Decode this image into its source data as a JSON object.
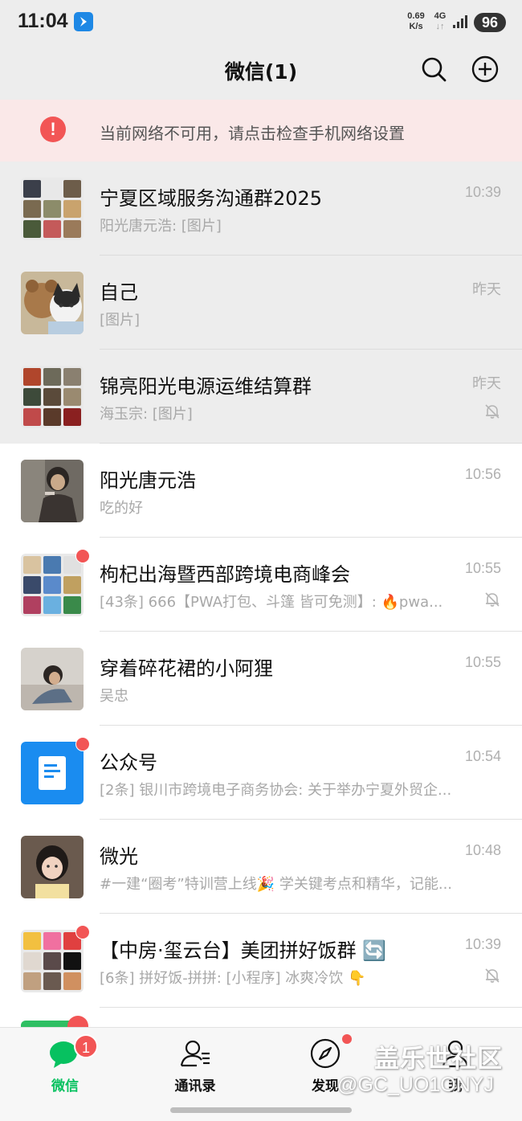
{
  "status_bar": {
    "time": "11:04",
    "speed_value": "0.69",
    "speed_unit": "K/s",
    "network_type": "4G",
    "network_arrows": "↓↑",
    "battery": "96"
  },
  "header": {
    "title": "微信(1)"
  },
  "banner": {
    "icon_text": "!",
    "message": "当前网络不可用，请点击检查手机网络设置"
  },
  "chats": [
    {
      "name": "宁夏区域服务沟通群2025",
      "preview": "阳光唐元浩: [图片]",
      "time": "10:39",
      "muted": false,
      "pinned": true,
      "unread_dot": false
    },
    {
      "name": "自己",
      "preview": "[图片]",
      "time": "昨天",
      "muted": false,
      "pinned": true,
      "unread_dot": false
    },
    {
      "name": "锦亮阳光电源运维结算群",
      "preview": "海玉宗: [图片]",
      "time": "昨天",
      "muted": true,
      "pinned": true,
      "unread_dot": false
    },
    {
      "name": "阳光唐元浩",
      "preview": "吃的好",
      "time": "10:56",
      "muted": false,
      "pinned": false,
      "unread_dot": false
    },
    {
      "name": "枸杞出海暨西部跨境电商峰会",
      "preview": "[43条] 666【PWA打包、斗篷 皆可免测】: 🔥pwa...",
      "time": "10:55",
      "muted": true,
      "pinned": false,
      "unread_dot": true
    },
    {
      "name": "穿着碎花裙的小阿狸",
      "preview": "吴忠",
      "time": "10:55",
      "muted": false,
      "pinned": false,
      "unread_dot": false
    },
    {
      "name": "公众号",
      "preview": "[2条] 银川市跨境电子商务协会: 关于举办宁夏外贸企...",
      "time": "10:54",
      "muted": false,
      "pinned": false,
      "unread_dot": true
    },
    {
      "name": "微光",
      "preview": "#一建“圈考”特训营上线🎉 学关键考点和精华，记能...",
      "time": "10:48",
      "muted": false,
      "pinned": false,
      "unread_dot": false
    },
    {
      "name": "【中房·玺云台】美团拼好饭群 🔄",
      "preview": "[6条] 拼好饭-拼拼: [小程序] 冰爽冷饮 👇",
      "time": "10:39",
      "muted": true,
      "pinned": false,
      "unread_dot": true
    }
  ],
  "tabs": [
    {
      "label": "微信",
      "icon": "chat-bubbles-icon",
      "badge": "1",
      "active": true
    },
    {
      "label": "通讯录",
      "icon": "contacts-icon",
      "badge": "",
      "active": false
    },
    {
      "label": "发现",
      "icon": "compass-icon",
      "badge": "",
      "active": false
    },
    {
      "label": "我",
      "icon": "person-icon",
      "badge": "",
      "active": false
    }
  ],
  "watermark": {
    "line1": "盖乐世社区",
    "line2": "@GC_UO1ONYJ"
  },
  "colors": {
    "accent": "#07c160",
    "badge": "#f25555",
    "banner_bg": "#fae8e8",
    "pinned_bg": "#ededed"
  }
}
